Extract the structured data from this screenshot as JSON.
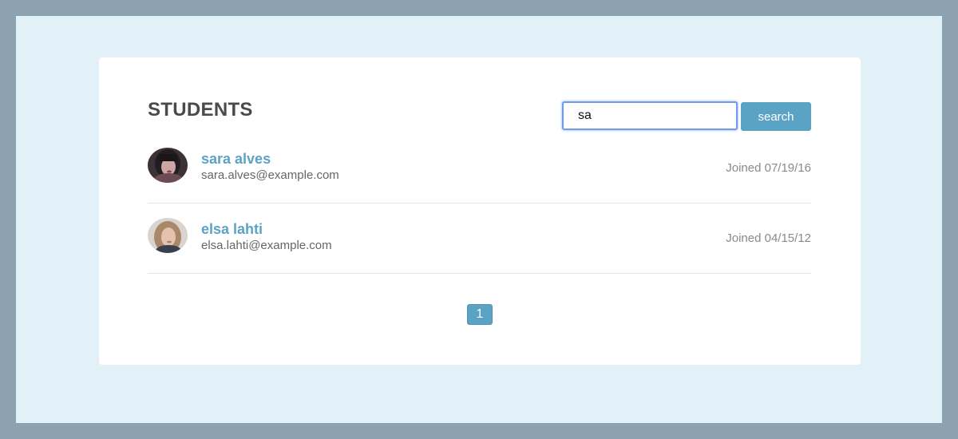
{
  "header": {
    "title": "STUDENTS"
  },
  "search": {
    "value": "sa",
    "button_label": "search"
  },
  "students": [
    {
      "name": "sara alves",
      "email": "sara.alves@example.com",
      "joined": "Joined 07/19/16"
    },
    {
      "name": "elsa lahti",
      "email": "elsa.lahti@example.com",
      "joined": "Joined 04/15/12"
    }
  ],
  "pagination": {
    "pages": [
      "1"
    ]
  },
  "colors": {
    "accent": "#5ba3c4",
    "frame": "#8da2b0",
    "backdrop": "#e2f0f7",
    "focus": "#6f9bea"
  }
}
